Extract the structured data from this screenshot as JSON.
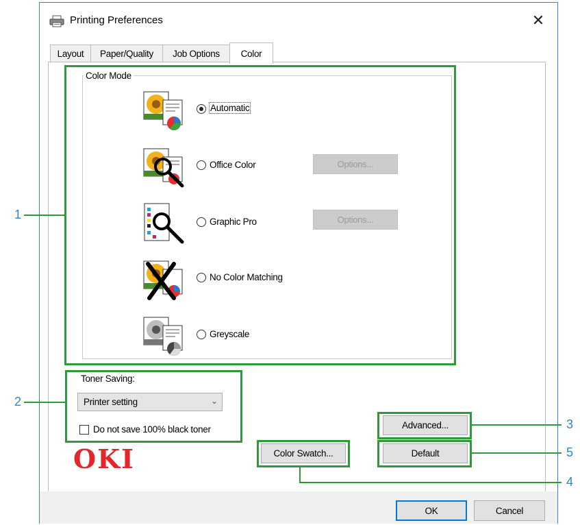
{
  "window": {
    "title": "Printing Preferences",
    "close_glyph": "✕"
  },
  "tabs": [
    {
      "label": "Layout"
    },
    {
      "label": "Paper/Quality"
    },
    {
      "label": "Job Options"
    },
    {
      "label": "Color",
      "active": true
    }
  ],
  "color_mode": {
    "legend": "Color Mode",
    "options": [
      {
        "label": "Automatic",
        "selected": true,
        "icon": "auto-color-icon"
      },
      {
        "label": "Office Color",
        "selected": false,
        "icon": "office-color-icon",
        "button": "Options..."
      },
      {
        "label": "Graphic Pro",
        "selected": false,
        "icon": "graphic-pro-icon",
        "button": "Options..."
      },
      {
        "label": "No Color Matching",
        "selected": false,
        "icon": "no-color-matching-icon"
      },
      {
        "label": "Greyscale",
        "selected": false,
        "icon": "greyscale-icon"
      }
    ]
  },
  "toner": {
    "label": "Toner Saving:",
    "selected": "Printer setting",
    "checkbox_label": "Do not save 100% black toner",
    "checkbox_checked": false
  },
  "buttons": {
    "advanced": "Advanced...",
    "default": "Default",
    "color_swatch": "Color Swatch...",
    "ok": "OK",
    "cancel": "Cancel"
  },
  "brand": {
    "logo": "OKI"
  },
  "callouts": [
    "1",
    "2",
    "3",
    "4",
    "5"
  ],
  "colors": {
    "callout_box": "#2e9a3a",
    "callout_number": "#2f86c8",
    "window_border": "#2f86c8",
    "logo": "#e3262a"
  }
}
